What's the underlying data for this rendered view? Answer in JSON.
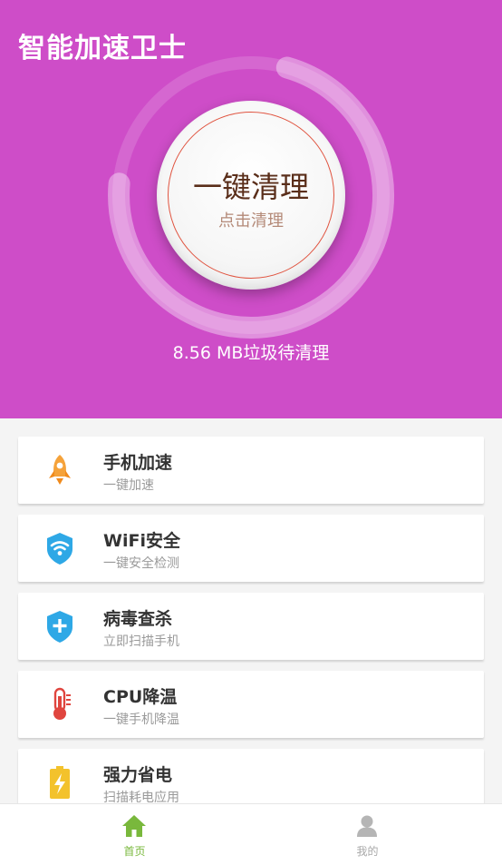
{
  "app": {
    "title": "智能加速卫士"
  },
  "colors": {
    "header_bg": "#ce4dc8",
    "accent_green": "#79b83c",
    "inactive_gray": "#a8a8a8"
  },
  "cleaner": {
    "button_title": "一键清理",
    "button_subtitle": "点击清理",
    "junk_status": "8.56 MB垃圾待清理",
    "progress_ring_fill": 0.72
  },
  "features": [
    {
      "name": "手机加速",
      "desc": "一键加速",
      "icon": "rocket-icon"
    },
    {
      "name": "WiFi安全",
      "desc": "一键安全检测",
      "icon": "wifi-shield-icon"
    },
    {
      "name": "病毒查杀",
      "desc": "立即扫描手机",
      "icon": "plus-shield-icon"
    },
    {
      "name": "CPU降温",
      "desc": "一键手机降温",
      "icon": "thermometer-icon"
    },
    {
      "name": "强力省电",
      "desc": "扫描耗电应用",
      "icon": "battery-icon"
    }
  ],
  "nav": {
    "home": {
      "label": "首页",
      "icon": "home-icon",
      "active": true
    },
    "mine": {
      "label": "我的",
      "icon": "user-icon",
      "active": false
    }
  }
}
